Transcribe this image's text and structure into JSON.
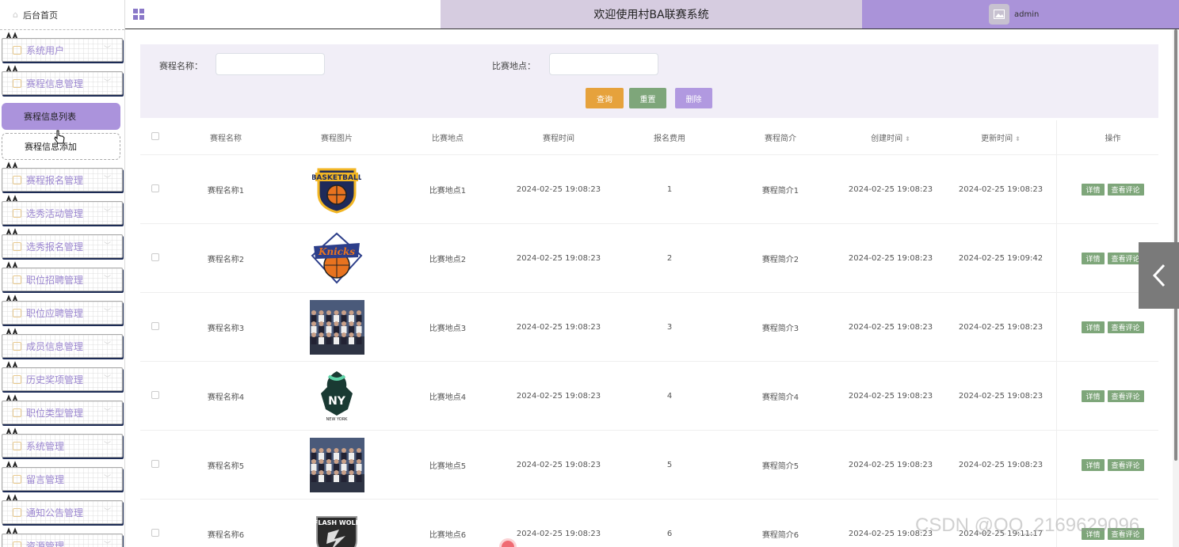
{
  "sidebar": {
    "home": "后台首页",
    "items": [
      {
        "label": "系统用户"
      },
      {
        "label": "赛程信息管理"
      },
      {
        "label": "赛程报名管理"
      },
      {
        "label": "选秀活动管理"
      },
      {
        "label": "选秀报名管理"
      },
      {
        "label": "职位招聘管理"
      },
      {
        "label": "职位应聘管理"
      },
      {
        "label": "成员信息管理"
      },
      {
        "label": "历史奖项管理"
      },
      {
        "label": "职位类型管理"
      },
      {
        "label": "系统管理"
      },
      {
        "label": "留言管理"
      },
      {
        "label": "通知公告管理"
      },
      {
        "label": "资源管理"
      }
    ],
    "submenu": {
      "active": "赛程信息列表",
      "second": "赛程信息添加"
    }
  },
  "header": {
    "title": "欢迎使用村BA联赛系统",
    "user": "admin"
  },
  "search": {
    "name_label": "赛程名称：",
    "location_label": "比赛地点：",
    "query_btn": "查询",
    "reset_btn": "重置",
    "delete_btn": "删除"
  },
  "table": {
    "headers": {
      "name": "赛程名称",
      "image": "赛程图片",
      "location": "比赛地点",
      "time": "赛程时间",
      "fee": "报名费用",
      "intro": "赛程简介",
      "created": "创建时间",
      "updated": "更新时间",
      "actions": "操作"
    },
    "detail_btn": "详情",
    "comment_btn": "查看评论",
    "rows": [
      {
        "name": "赛程名称1",
        "location": "比赛地点1",
        "time": "2024-02-25 19:08:23",
        "fee": "1",
        "intro": "赛程简介1",
        "created": "2024-02-25 19:08:23",
        "updated": "2024-02-25 19:08:23",
        "image": "basketball-logo"
      },
      {
        "name": "赛程名称2",
        "location": "比赛地点2",
        "time": "2024-02-25 19:08:23",
        "fee": "2",
        "intro": "赛程简介2",
        "created": "2024-02-25 19:08:23",
        "updated": "2024-02-25 19:09:42",
        "image": "knicks-logo"
      },
      {
        "name": "赛程名称3",
        "location": "比赛地点3",
        "time": "2024-02-25 19:08:23",
        "fee": "3",
        "intro": "赛程简介3",
        "created": "2024-02-25 19:08:23",
        "updated": "2024-02-25 19:08:23",
        "image": "team-photo"
      },
      {
        "name": "赛程名称4",
        "location": "比赛地点4",
        "time": "2024-02-25 19:08:23",
        "fee": "4",
        "intro": "赛程简介4",
        "created": "2024-02-25 19:08:23",
        "updated": "2024-02-25 19:08:23",
        "image": "ny-liberty-logo"
      },
      {
        "name": "赛程名称5",
        "location": "比赛地点5",
        "time": "2024-02-25 19:08:23",
        "fee": "5",
        "intro": "赛程简介5",
        "created": "2024-02-25 19:08:23",
        "updated": "2024-02-25 19:08:23",
        "image": "team-photo"
      },
      {
        "name": "赛程名称6",
        "location": "比赛地点6",
        "time": "2024-02-25 19:08:23",
        "fee": "6",
        "intro": "赛程简介6",
        "created": "2024-02-25 19:08:23",
        "updated": "2024-02-25 19:11:17",
        "image": "flash-wolf-logo"
      }
    ]
  },
  "watermark": "CSDN @QQ_2169629096",
  "colors": {
    "accent": "#ab93dc",
    "header_mid": "#d6cce0",
    "action_green": "#7ea67a",
    "query_orange": "#e6a23c",
    "reset_green": "#7ea67a",
    "delete_purple": "#b199e0"
  }
}
